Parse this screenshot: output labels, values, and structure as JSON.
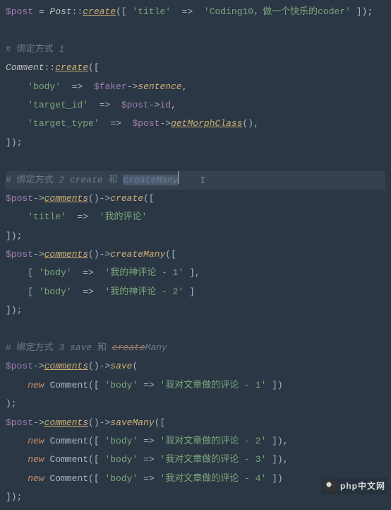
{
  "code": {
    "l1": {
      "var": "$post",
      "eq": " = ",
      "cls": "Post",
      "dbl": "::",
      "m": "create",
      "p1": "([ ",
      "k1": "'title'",
      "arr": "  =>  ",
      "s1": "'Coding10，做一个快乐的coder'",
      "p2": " ]);"
    },
    "l3": {
      "c": "# 绑定方式 ",
      "n": "1"
    },
    "l4": {
      "cls": "Comment",
      "dbl": "::",
      "m": "create",
      "p": "(["
    },
    "l5": {
      "k": "'body'",
      "arr": "  =>  ",
      "v": "$faker",
      "a": "->",
      "m": "sentence",
      "e": ","
    },
    "l6": {
      "k": "'target_id'",
      "arr": "  =>  ",
      "v": "$post",
      "a": "->",
      "p": "id",
      "e": ","
    },
    "l7": {
      "k": "'target_type'",
      "arr": "  =>  ",
      "v": "$post",
      "a": "->",
      "m": "getMorphClass",
      "p": "(),"
    },
    "l8": "]);",
    "l10": {
      "c1": "# 绑定方式 ",
      "n": "2 create ",
      "c2": "和 ",
      "sel": "createMany"
    },
    "l11": {
      "v": "$post",
      "a": "->",
      "m": "comments",
      "p1": "()->",
      "m2": "create",
      "p2": "(["
    },
    "l12": {
      "k": "'title'",
      "arr": "  =>  ",
      "s": "'我的评论'"
    },
    "l13": "]);",
    "l14": {
      "v": "$post",
      "a": "->",
      "m": "comments",
      "p1": "()->",
      "m2": "createMany",
      "p2": "(["
    },
    "l15": {
      "p1": "[ ",
      "k": "'body'",
      "arr": "  =>  ",
      "s": "'我的神评论 - 1'",
      "p2": " ],"
    },
    "l16": {
      "p1": "[ ",
      "k": "'body'",
      "arr": "  =>  ",
      "s": "'我的神评论 - 2'",
      "p2": " ]"
    },
    "l17": "]);",
    "l19": {
      "c1": "# 绑定方式 ",
      "n": "3 save ",
      "c2": "和 ",
      "st1": "create",
      "c3": "Many"
    },
    "l20": {
      "v": "$post",
      "a": "->",
      "m": "comments",
      "p1": "()->",
      "m2": "save",
      "p2": "("
    },
    "l21": {
      "kw": "new",
      "sp": " ",
      "cls": "Comment",
      "p1": "([ ",
      "k": "'body'",
      "arr": " => ",
      "s": "'我对文章做的评论 - 1'",
      "p2": " ])"
    },
    "l22": ");",
    "l23": {
      "v": "$post",
      "a": "->",
      "m": "comments",
      "p1": "()->",
      "m2": "saveMany",
      "p2": "(["
    },
    "l24": {
      "kw": "new",
      "sp": " ",
      "cls": "Comment",
      "p1": "([ ",
      "k": "'body'",
      "arr": " => ",
      "s": "'我对文章做的评论 - 2'",
      "p2": " ]),"
    },
    "l25": {
      "kw": "new",
      "sp": " ",
      "cls": "Comment",
      "p1": "([ ",
      "k": "'body'",
      "arr": " => ",
      "s": "'我对文章做的评论 - 3'",
      "p2": " ]),"
    },
    "l26": {
      "kw": "new",
      "sp": " ",
      "cls": "Comment",
      "p1": "([ ",
      "k": "'body'",
      "arr": " => ",
      "s": "'我对文章做的评论 - 4'",
      "p2": " ])"
    },
    "l27": "]);"
  },
  "logo_text": "php中文网",
  "cursor_char": "I"
}
